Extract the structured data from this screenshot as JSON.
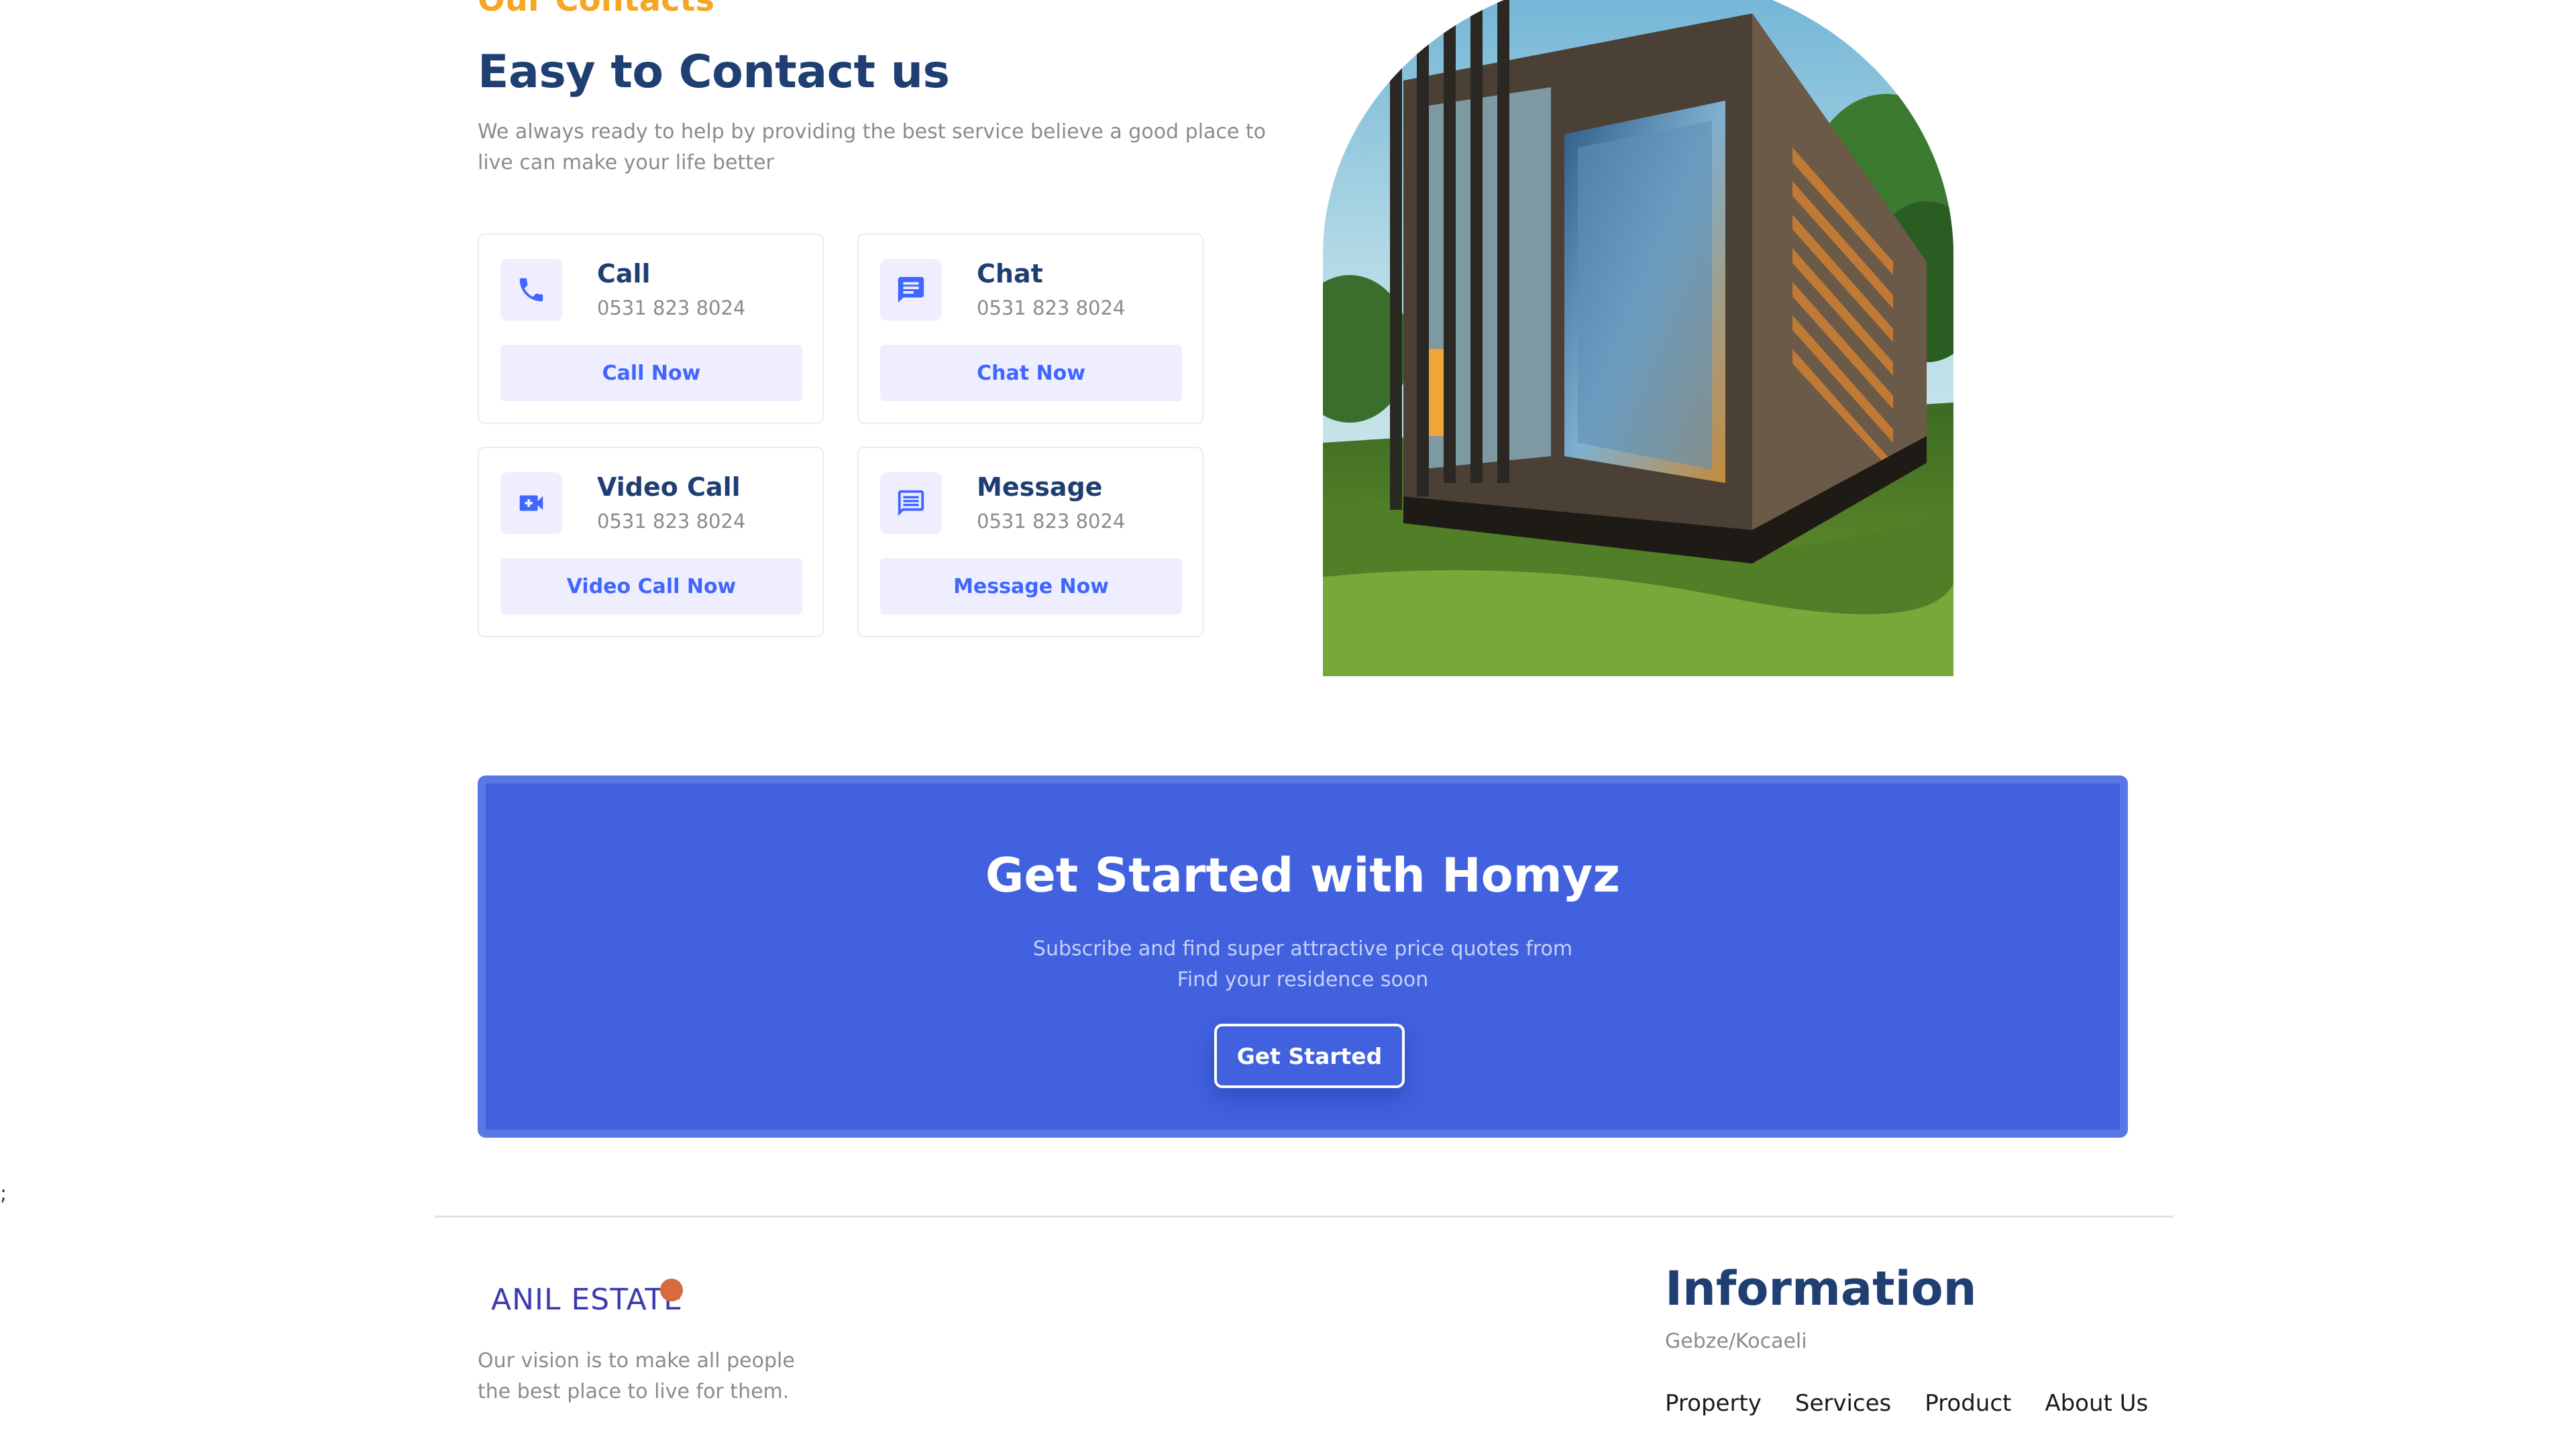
{
  "section": {
    "label": "Our Contacts",
    "title": "Easy to Contact us",
    "description": "We always ready to help by providing the best service believe a good place to live can make your life better"
  },
  "cards": [
    {
      "title": "Call",
      "phone": "0531 823 8024",
      "button": "Call Now",
      "icon": "phone-icon"
    },
    {
      "title": "Chat",
      "phone": "0531 823 8024",
      "button": "Chat Now",
      "icon": "chat-icon"
    },
    {
      "title": "Video Call",
      "phone": "0531 823 8024",
      "button": "Video Call Now",
      "icon": "video-call-icon"
    },
    {
      "title": "Message",
      "phone": "0531 823 8024",
      "button": "Message Now",
      "icon": "message-icon"
    }
  ],
  "banner": {
    "title": "Get Started with Homyz",
    "subtitle_line1": "Subscribe and find super attractive price quotes from",
    "subtitle_line2": "Find your residence soon",
    "button": "Get Started"
  },
  "stray_text": ";",
  "footer": {
    "brand": "ANIL ESTATE",
    "vision_line1": "Our vision is to make all people",
    "vision_line2": "the best place to live for them.",
    "info_title": "Information",
    "info_city": "Gebze/Kocaeli",
    "links": [
      "Property",
      "Services",
      "Product",
      "About Us"
    ]
  },
  "colors": {
    "accent_orange": "#f5a623",
    "heading_navy": "#1f3e72",
    "primary_blue": "#4066ff",
    "banner_blue": "#4161df",
    "soft_lavender": "#eeeeff",
    "muted_gray": "#8c8b8b"
  }
}
